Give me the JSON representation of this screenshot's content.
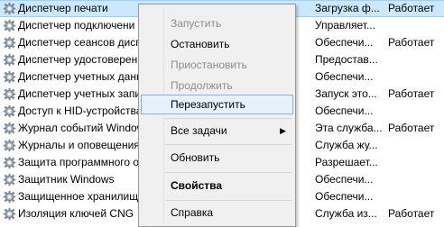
{
  "services": [
    {
      "name": "Диспетчер печати",
      "desc": "Загрузка ф...",
      "status": "Работает",
      "selected": true
    },
    {
      "name": "Диспетчер подключени",
      "desc": "Управляет...",
      "status": "",
      "selected": false
    },
    {
      "name": "Диспетчер сеансов дисп",
      "desc": "Обеспечи...",
      "status": "Работает",
      "selected": false
    },
    {
      "name": "Диспетчер удостоверени",
      "desc": "Предостав...",
      "status": "",
      "selected": false
    },
    {
      "name": "Диспетчер учетных данн",
      "desc": "Обеспечи...",
      "status": "",
      "selected": false
    },
    {
      "name": "Диспетчер учетных запи",
      "desc": "Запуск это...",
      "status": "Работает",
      "selected": false
    },
    {
      "name": "Доступ к HID-устройства",
      "desc": "Обеспечи...",
      "status": "",
      "selected": false
    },
    {
      "name": "Журнал событий Window",
      "desc": "Эта служба...",
      "status": "Работает",
      "selected": false
    },
    {
      "name": "Журналы и оповещения",
      "desc": "Служба жу...",
      "status": "",
      "selected": false
    },
    {
      "name": "Защита программного о",
      "desc": "Разрешает...",
      "status": "",
      "selected": false
    },
    {
      "name": "Защитник Windows",
      "desc": "Обеспечи...",
      "status": "",
      "selected": false
    },
    {
      "name": "Защищенное хранилищ",
      "desc": "Обеспечи...",
      "status": "",
      "selected": false
    },
    {
      "name": "Изоляция ключей CNG",
      "desc": "Служба из...",
      "status": "Работает",
      "selected": false
    }
  ],
  "context_menu": {
    "start": "Запустить",
    "stop": "Остановить",
    "pause": "Приостановить",
    "resume": "Продолжить",
    "restart": "Перезапустить",
    "all_tasks": "Все задачи",
    "all_tasks_arrow": "▶",
    "refresh": "Обновить",
    "properties": "Свойства",
    "help": "Справка"
  },
  "colors": {
    "selection": "#cce8ff",
    "menu_hover": "#e5f1fb",
    "disabled_text": "#8d8d8d"
  }
}
